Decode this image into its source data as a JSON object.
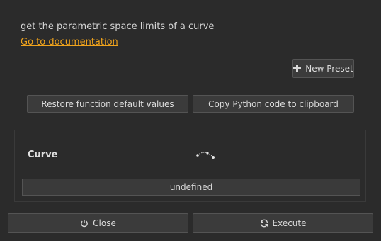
{
  "header": {
    "description": "get the parametric space limits of a curve",
    "doc_link": "Go to documentation"
  },
  "toolbar": {
    "new_preset_label": "New Preset",
    "restore_label": "Restore function default values",
    "copy_label": "Copy Python code to clipboard"
  },
  "parameter": {
    "label": "Curve",
    "icon": "curve-icon",
    "value": "undefined"
  },
  "footer": {
    "close_label": "Close",
    "execute_label": "Execute"
  },
  "colors": {
    "background": "#2b2b2b",
    "link": "#f0a31c",
    "button": "#3b3b3b"
  }
}
